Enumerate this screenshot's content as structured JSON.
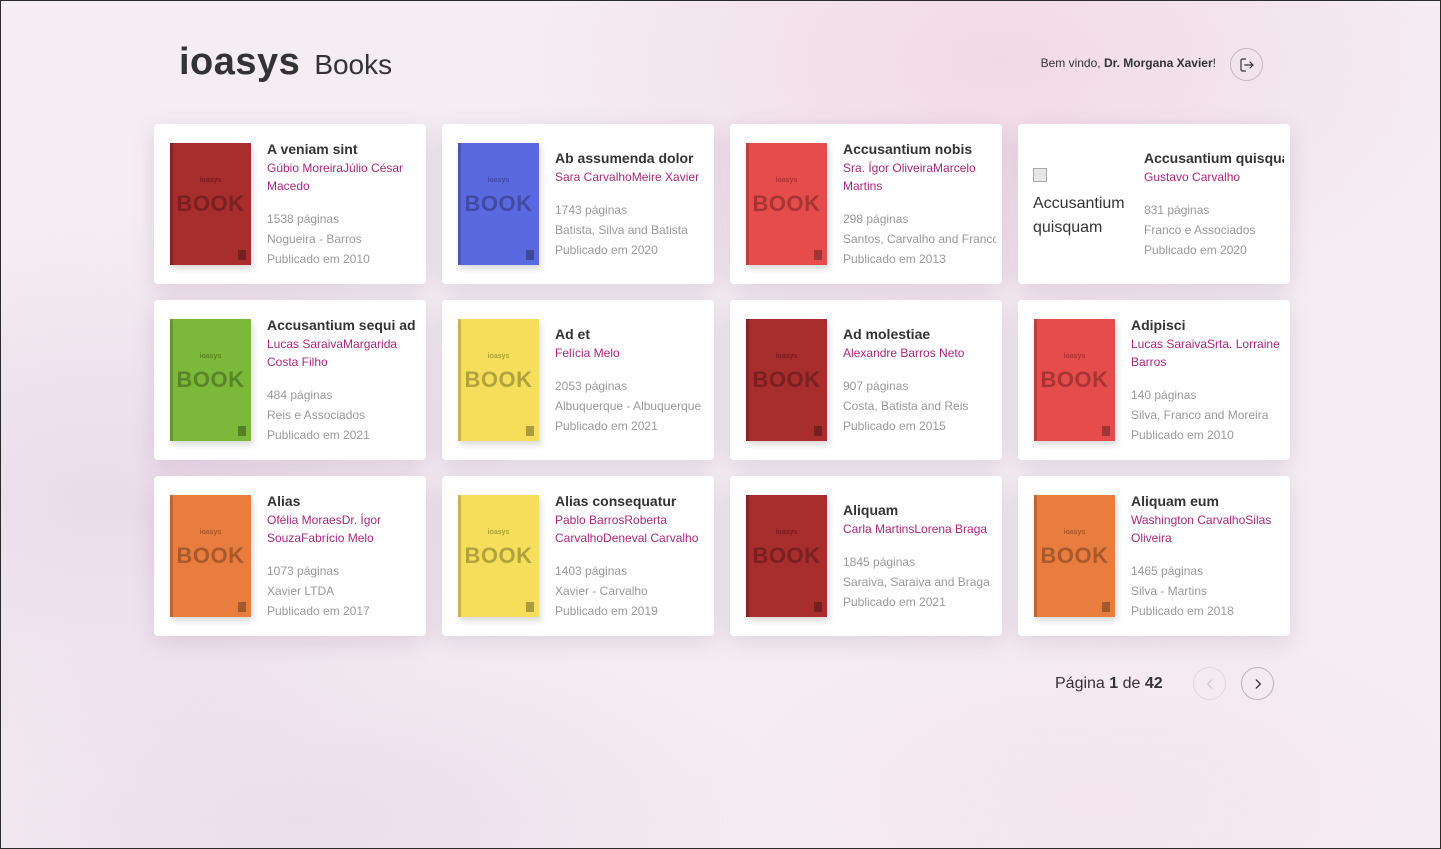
{
  "header": {
    "brand": "ioasys",
    "product": "Books",
    "welcome_prefix": "Bem vindo, ",
    "user_name": "Dr. Morgana Xavier",
    "welcome_suffix": "!",
    "logout_icon": "logout-icon"
  },
  "cover": {
    "mini": "ioasys",
    "word": "BOOK"
  },
  "books": [
    {
      "title": "A veniam sint",
      "authors": "Gúbio MoreiraJúlio César Macedo",
      "pages": "1538 páginas",
      "publisher": "Nogueira - Barros",
      "published": "Publicado em 2010",
      "cover_color": "#a82d2d"
    },
    {
      "title": "Ab assumenda dolor",
      "authors": "Sara CarvalhoMeire Xavier",
      "pages": "1743 páginas",
      "publisher": "Batista, Silva and Batista",
      "published": "Publicado em 2020",
      "cover_color": "#5b69e0"
    },
    {
      "title": "Accusantium nobis",
      "authors": "Sra. Ígor OliveiraMarcelo Martins",
      "pages": "298 páginas",
      "publisher": "Santos, Carvalho and Franco",
      "published": "Publicado em 2013",
      "cover_color": "#e74c4c"
    },
    {
      "title": "Accusantium quisquam",
      "authors": "Gustavo Carvalho",
      "pages": "831 páginas",
      "publisher": "Franco e Associados",
      "published": "Publicado em 2020",
      "cover_color": "",
      "cover_alt": "Accusantium quisquam"
    },
    {
      "title": "Accusantium sequi ad",
      "authors": "Lucas SaraivaMargarida Costa Filho",
      "pages": "484 páginas",
      "publisher": "Reis e Associados",
      "published": "Publicado em 2021",
      "cover_color": "#7cb83a"
    },
    {
      "title": "Ad et",
      "authors": "Felícia Melo",
      "pages": "2053 páginas",
      "publisher": "Albuquerque - Albuquerque",
      "published": "Publicado em 2021",
      "cover_color": "#f5df5a"
    },
    {
      "title": "Ad molestiae",
      "authors": "Alexandre Barros Neto",
      "pages": "907 páginas",
      "publisher": "Costa, Batista and Reis",
      "published": "Publicado em 2015",
      "cover_color": "#a82d2d"
    },
    {
      "title": "Adipisci",
      "authors": "Lucas SaraivaSrta. Lorraine Barros",
      "pages": "140 páginas",
      "publisher": "Silva, Franco and Moreira",
      "published": "Publicado em 2010",
      "cover_color": "#e74c4c"
    },
    {
      "title": "Alias",
      "authors": "Ofélia MoraesDr. Ígor SouzaFabrício Melo",
      "pages": "1073 páginas",
      "publisher": "Xavier LTDA",
      "published": "Publicado em 2017",
      "cover_color": "#e97d3f"
    },
    {
      "title": "Alias consequatur",
      "authors": "Pablo BarrosRoberta CarvalhoDeneval Carvalho",
      "pages": "1403 páginas",
      "publisher": "Xavier - Carvalho",
      "published": "Publicado em 2019",
      "cover_color": "#f5df5a"
    },
    {
      "title": "Aliquam",
      "authors": "Carla MartinsLorena Braga",
      "pages": "1845 páginas",
      "publisher": "Saraiva, Saraiva and Braga",
      "published": "Publicado em 2021",
      "cover_color": "#a82d2d"
    },
    {
      "title": "Aliquam eum",
      "authors": "Washington CarvalhoSilas Oliveira",
      "pages": "1465 páginas",
      "publisher": "Silva - Martins",
      "published": "Publicado em 2018",
      "cover_color": "#e97d3f"
    }
  ],
  "pagination": {
    "prefix": "Página ",
    "current": "1",
    "middle": " de ",
    "total": "42",
    "prev_icon": "chevron-left-icon",
    "next_icon": "chevron-right-icon"
  }
}
